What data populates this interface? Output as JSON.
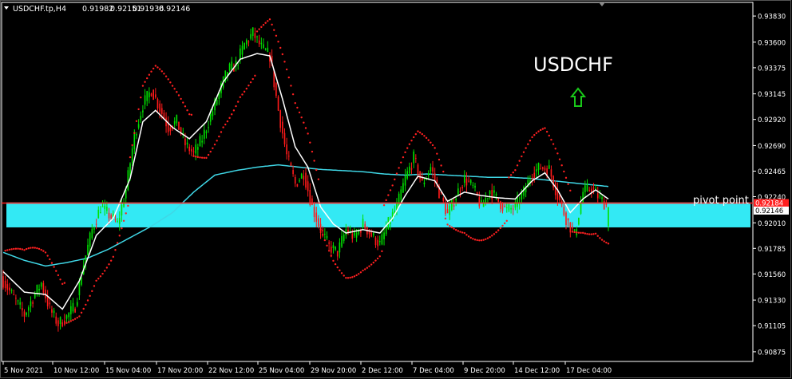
{
  "header": {
    "symbol_timeframe": "USDCHF.tp,H4",
    "open": "0.91982",
    "high": "0.92151",
    "low": "0.91936",
    "close": "0.92146"
  },
  "annotations": {
    "title": "USDCHF",
    "pivot_label": "pivot point",
    "arrow_direction": "up"
  },
  "colors": {
    "background": "#000000",
    "bull_candle": "#00e000",
    "bear_candle": "#ff1a1a",
    "ma_fast": "#ffffff",
    "ma_slow": "#3fd7e6",
    "psar": "#ff2020",
    "pivot_line": "#ff2020",
    "zone": "#33e9f4",
    "arrow": "#19c819",
    "axis": "#ffffff"
  },
  "chart_data": {
    "type": "candlestick",
    "title": "USDCHF",
    "ylim": [
      0.9079,
      0.9395
    ],
    "y_ticks": [
      "0.93830",
      "0.93600",
      "0.93375",
      "0.93145",
      "0.92920",
      "0.92690",
      "0.92465",
      "0.92240",
      "0.92010",
      "0.91785",
      "0.91560",
      "0.91330",
      "0.91105",
      "0.90875"
    ],
    "x_ticks": [
      "5 Nov 2021",
      "10 Nov 12:00",
      "15 Nov 04:00",
      "17 Nov 20:00",
      "22 Nov 12:00",
      "25 Nov 04:00",
      "29 Nov 20:00",
      "2 Dec 12:00",
      "7 Dec 04:00",
      "9 Dec 20:00",
      "14 Dec 12:00",
      "17 Dec 04:00"
    ],
    "price_labels": {
      "pivot": "0.92184",
      "current": "0.92146"
    },
    "pivot_point": 0.92184,
    "current_price": 0.92146,
    "support_zone": [
      0.9197,
      0.9219
    ],
    "ohlc_last": {
      "open": 0.91982,
      "high": 0.92151,
      "low": 0.91936,
      "close": 0.92146
    },
    "close_path": [
      [
        0,
        0.915
      ],
      [
        6,
        0.9132
      ],
      [
        10,
        0.912
      ],
      [
        14,
        0.9135
      ],
      [
        18,
        0.9148
      ],
      [
        22,
        0.9125
      ],
      [
        26,
        0.9112
      ],
      [
        30,
        0.9118
      ],
      [
        34,
        0.9128
      ],
      [
        38,
        0.9165
      ],
      [
        42,
        0.9195
      ],
      [
        46,
        0.9215
      ],
      [
        50,
        0.9208
      ],
      [
        54,
        0.92
      ],
      [
        58,
        0.923
      ],
      [
        62,
        0.9278
      ],
      [
        66,
        0.9305
      ],
      [
        70,
        0.9318
      ],
      [
        74,
        0.9302
      ],
      [
        78,
        0.9285
      ],
      [
        82,
        0.929
      ],
      [
        86,
        0.927
      ],
      [
        90,
        0.9262
      ],
      [
        94,
        0.9275
      ],
      [
        98,
        0.9295
      ],
      [
        102,
        0.9315
      ],
      [
        106,
        0.9335
      ],
      [
        110,
        0.934
      ],
      [
        114,
        0.9358
      ],
      [
        118,
        0.9368
      ],
      [
        122,
        0.9355
      ],
      [
        126,
        0.9348
      ],
      [
        130,
        0.93
      ],
      [
        134,
        0.926
      ],
      [
        138,
        0.9235
      ],
      [
        142,
        0.9245
      ],
      [
        146,
        0.9215
      ],
      [
        150,
        0.9195
      ],
      [
        154,
        0.918
      ],
      [
        158,
        0.9175
      ],
      [
        162,
        0.9195
      ],
      [
        166,
        0.9188
      ],
      [
        170,
        0.92
      ],
      [
        174,
        0.919
      ],
      [
        178,
        0.9182
      ],
      [
        182,
        0.92
      ],
      [
        186,
        0.9215
      ],
      [
        190,
        0.924
      ],
      [
        194,
        0.9258
      ],
      [
        198,
        0.9235
      ],
      [
        202,
        0.925
      ],
      [
        206,
        0.9228
      ],
      [
        210,
        0.9208
      ],
      [
        214,
        0.9225
      ],
      [
        218,
        0.924
      ],
      [
        222,
        0.9232
      ],
      [
        226,
        0.9215
      ],
      [
        230,
        0.923
      ],
      [
        234,
        0.922
      ],
      [
        238,
        0.9212
      ],
      [
        242,
        0.9215
      ],
      [
        246,
        0.9228
      ],
      [
        250,
        0.9245
      ],
      [
        254,
        0.925
      ],
      [
        258,
        0.9248
      ],
      [
        262,
        0.9225
      ],
      [
        266,
        0.9205
      ],
      [
        270,
        0.919
      ],
      [
        274,
        0.9228
      ],
      [
        278,
        0.9232
      ],
      [
        282,
        0.9222
      ],
      [
        286,
        0.9215
      ]
    ],
    "ma_fast_path": [
      [
        0,
        0.9158
      ],
      [
        10,
        0.914
      ],
      [
        20,
        0.9138
      ],
      [
        28,
        0.9125
      ],
      [
        36,
        0.915
      ],
      [
        44,
        0.919
      ],
      [
        52,
        0.9205
      ],
      [
        60,
        0.924
      ],
      [
        66,
        0.929
      ],
      [
        72,
        0.93
      ],
      [
        80,
        0.9285
      ],
      [
        88,
        0.9275
      ],
      [
        96,
        0.929
      ],
      [
        104,
        0.9325
      ],
      [
        112,
        0.9345
      ],
      [
        120,
        0.935
      ],
      [
        126,
        0.9348
      ],
      [
        132,
        0.931
      ],
      [
        138,
        0.9268
      ],
      [
        144,
        0.925
      ],
      [
        150,
        0.9215
      ],
      [
        156,
        0.92
      ],
      [
        162,
        0.9192
      ],
      [
        170,
        0.9195
      ],
      [
        178,
        0.9192
      ],
      [
        184,
        0.9205
      ],
      [
        190,
        0.9225
      ],
      [
        196,
        0.9242
      ],
      [
        204,
        0.9238
      ],
      [
        210,
        0.922
      ],
      [
        218,
        0.9228
      ],
      [
        226,
        0.9225
      ],
      [
        234,
        0.9223
      ],
      [
        242,
        0.9222
      ],
      [
        250,
        0.9238
      ],
      [
        256,
        0.9245
      ],
      [
        262,
        0.923
      ],
      [
        268,
        0.921
      ],
      [
        274,
        0.9222
      ],
      [
        280,
        0.923
      ],
      [
        286,
        0.9222
      ]
    ],
    "ma_slow_path": [
      [
        0,
        0.9175
      ],
      [
        10,
        0.9168
      ],
      [
        20,
        0.9163
      ],
      [
        30,
        0.9166
      ],
      [
        40,
        0.917
      ],
      [
        50,
        0.9178
      ],
      [
        60,
        0.9188
      ],
      [
        70,
        0.9198
      ],
      [
        80,
        0.921
      ],
      [
        90,
        0.9228
      ],
      [
        100,
        0.9243
      ],
      [
        110,
        0.9247
      ],
      [
        120,
        0.925
      ],
      [
        130,
        0.9252
      ],
      [
        140,
        0.925
      ],
      [
        150,
        0.9248
      ],
      [
        160,
        0.9247
      ],
      [
        170,
        0.9246
      ],
      [
        180,
        0.9244
      ],
      [
        190,
        0.9243
      ],
      [
        200,
        0.9244
      ],
      [
        210,
        0.9243
      ],
      [
        220,
        0.9242
      ],
      [
        230,
        0.9241
      ],
      [
        240,
        0.9241
      ],
      [
        250,
        0.924
      ],
      [
        260,
        0.9238
      ],
      [
        270,
        0.9236
      ],
      [
        286,
        0.9233
      ]
    ]
  }
}
